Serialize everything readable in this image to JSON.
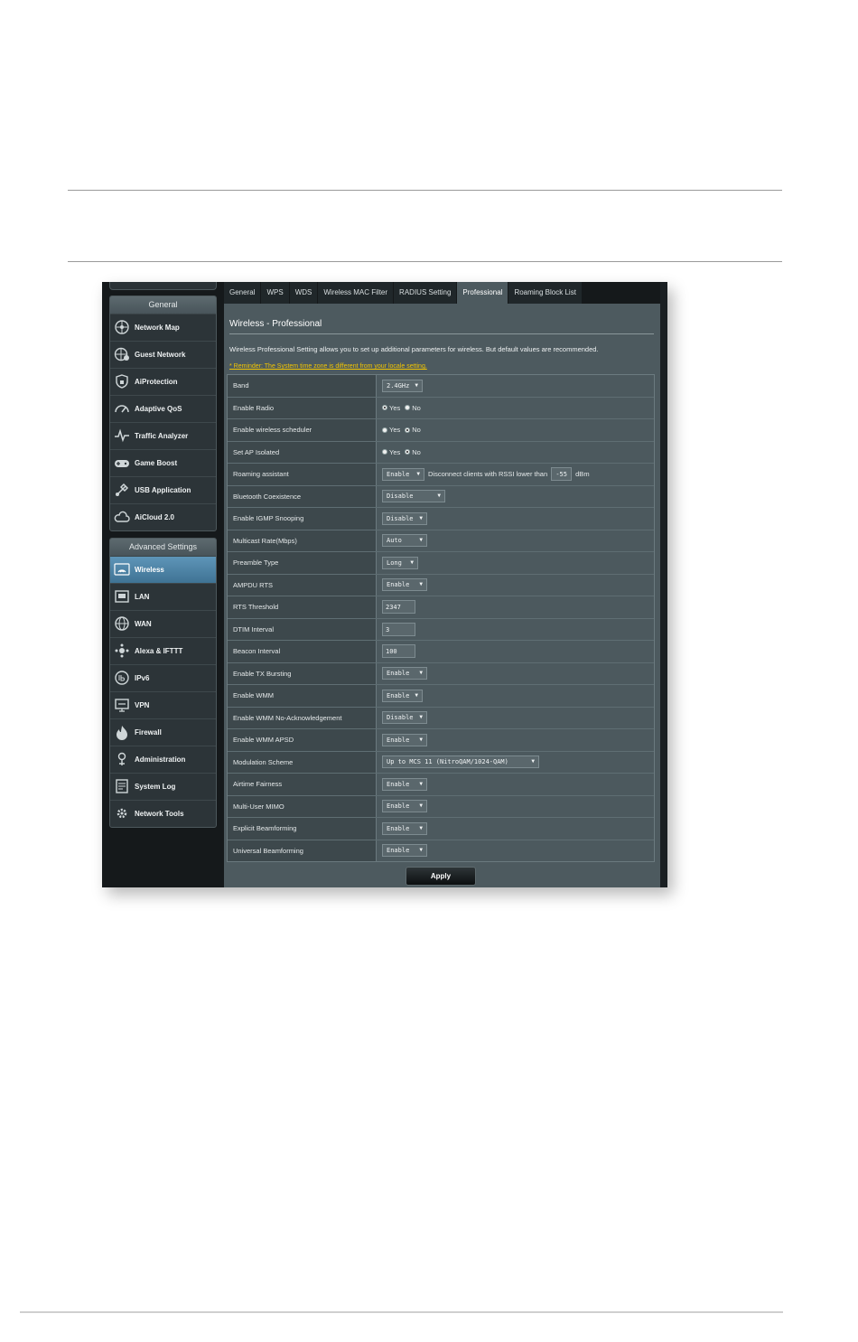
{
  "sidebar": {
    "general_header": "General",
    "general_items": [
      {
        "label": "Network Map",
        "icon": "network-map-icon"
      },
      {
        "label": "Guest Network",
        "icon": "guest-network-icon"
      },
      {
        "label": "AiProtection",
        "icon": "shield-icon"
      },
      {
        "label": "Adaptive QoS",
        "icon": "gauge-icon"
      },
      {
        "label": "Traffic Analyzer",
        "icon": "pulse-icon"
      },
      {
        "label": "Game Boost",
        "icon": "gamepad-icon"
      },
      {
        "label": "USB Application",
        "icon": "usb-icon"
      },
      {
        "label": "AiCloud 2.0",
        "icon": "cloud-icon"
      }
    ],
    "advanced_header": "Advanced Settings",
    "advanced_items": [
      {
        "label": "Wireless",
        "icon": "wireless-icon",
        "active": true
      },
      {
        "label": "LAN",
        "icon": "lan-icon"
      },
      {
        "label": "WAN",
        "icon": "globe-icon"
      },
      {
        "label": "Alexa & IFTTT",
        "icon": "alexa-icon"
      },
      {
        "label": "IPv6",
        "icon": "ipv6-icon"
      },
      {
        "label": "VPN",
        "icon": "vpn-icon"
      },
      {
        "label": "Firewall",
        "icon": "firewall-icon"
      },
      {
        "label": "Administration",
        "icon": "admin-icon"
      },
      {
        "label": "System Log",
        "icon": "system-log-icon"
      },
      {
        "label": "Network Tools",
        "icon": "tools-icon"
      }
    ]
  },
  "tabs": [
    "General",
    "WPS",
    "WDS",
    "Wireless MAC Filter",
    "RADIUS Setting",
    "Professional",
    "Roaming Block List"
  ],
  "active_tab": "Professional",
  "page": {
    "title": "Wireless - Professional",
    "description": "Wireless Professional Setting allows you to set up additional parameters for wireless. But default values are recommended.",
    "reminder": "* Reminder: The System time zone is different from your locale setting."
  },
  "radio_labels": {
    "yes": "Yes",
    "no": "No"
  },
  "roaming": {
    "select": "Enable",
    "text": "Disconnect clients with RSSI lower than",
    "rssi": "-55",
    "unit": "dBm"
  },
  "settings": [
    {
      "label": "Band",
      "type": "select",
      "value": "2.4GHz",
      "width": 45
    },
    {
      "label": "Enable Radio",
      "type": "radio",
      "value": "Yes"
    },
    {
      "label": "Enable wireless scheduler",
      "type": "radio",
      "value": "No"
    },
    {
      "label": "Set AP Isolated",
      "type": "radio",
      "value": "No"
    },
    {
      "label": "Roaming assistant",
      "type": "roaming"
    },
    {
      "label": "Bluetooth Coexistence",
      "type": "select",
      "value": "Disable",
      "width": 70
    },
    {
      "label": "Enable IGMP Snooping",
      "type": "select",
      "value": "Disable",
      "width": 50
    },
    {
      "label": "Multicast Rate(Mbps)",
      "type": "select",
      "value": "Auto",
      "width": 50
    },
    {
      "label": "Preamble Type",
      "type": "select",
      "value": "Long",
      "width": 40
    },
    {
      "label": "AMPDU RTS",
      "type": "select",
      "value": "Enable",
      "width": 50
    },
    {
      "label": "RTS Threshold",
      "type": "text",
      "value": "2347"
    },
    {
      "label": "DTIM Interval",
      "type": "text",
      "value": "3"
    },
    {
      "label": "Beacon Interval",
      "type": "text",
      "value": "100"
    },
    {
      "label": "Enable TX Bursting",
      "type": "select",
      "value": "Enable",
      "width": 50
    },
    {
      "label": "Enable WMM",
      "type": "select",
      "value": "Enable",
      "width": 45
    },
    {
      "label": "Enable WMM No-Acknowledgement",
      "type": "select",
      "value": "Disable",
      "width": 50
    },
    {
      "label": "Enable WMM APSD",
      "type": "select",
      "value": "Enable",
      "width": 50
    },
    {
      "label": "Modulation Scheme",
      "type": "select",
      "value": "Up to MCS 11 (NitroQAM/1024-QAM)",
      "width": 174
    },
    {
      "label": "Airtime Fairness",
      "type": "select",
      "value": "Enable",
      "width": 50
    },
    {
      "label": "Multi-User MIMO",
      "type": "select",
      "value": "Enable",
      "width": 50
    },
    {
      "label": "Explicit Beamforming",
      "type": "select",
      "value": "Enable",
      "width": 50
    },
    {
      "label": "Universal Beamforming",
      "type": "select",
      "value": "Enable",
      "width": 50
    }
  ],
  "apply_label": "Apply"
}
